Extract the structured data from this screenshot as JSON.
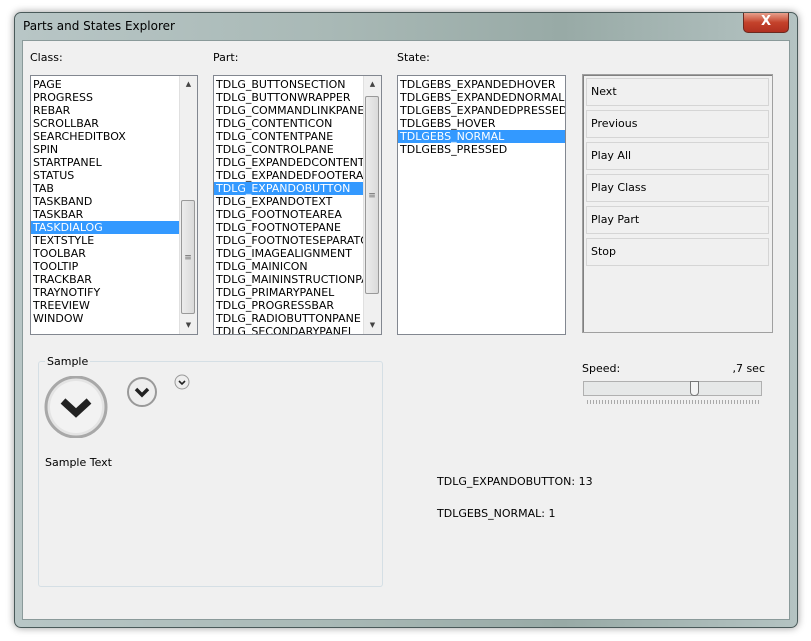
{
  "window": {
    "title": "Parts and States Explorer",
    "close_label": "X"
  },
  "class": {
    "label": "Class:",
    "items": [
      "PAGE",
      "PROGRESS",
      "REBAR",
      "SCROLLBAR",
      "SEARCHEDITBOX",
      "SPIN",
      "STARTPANEL",
      "STATUS",
      "TAB",
      "TASKBAND",
      "TASKBAR",
      "TASKDIALOG",
      "TEXTSTYLE",
      "TOOLBAR",
      "TOOLTIP",
      "TRACKBAR",
      "TRAYNOTIFY",
      "TREEVIEW",
      "WINDOW"
    ],
    "selected": "TASKDIALOG"
  },
  "part": {
    "label": "Part:",
    "items": [
      "TDLG_BUTTONSECTION",
      "TDLG_BUTTONWRAPPER",
      "TDLG_COMMANDLINKPANE",
      "TDLG_CONTENTICON",
      "TDLG_CONTENTPANE",
      "TDLG_CONTROLPANE",
      "TDLG_EXPANDEDCONTENT",
      "TDLG_EXPANDEDFOOTERAREA",
      "TDLG_EXPANDOBUTTON",
      "TDLG_EXPANDOTEXT",
      "TDLG_FOOTNOTEAREA",
      "TDLG_FOOTNOTEPANE",
      "TDLG_FOOTNOTESEPARATOR",
      "TDLG_IMAGEALIGNMENT",
      "TDLG_MAINICON",
      "TDLG_MAININSTRUCTIONPANE",
      "TDLG_PRIMARYPANEL",
      "TDLG_PROGRESSBAR",
      "TDLG_RADIOBUTTONPANE",
      "TDLG_SECONDARYPANEL"
    ],
    "selected": "TDLG_EXPANDOBUTTON"
  },
  "state": {
    "label": "State:",
    "items": [
      "TDLGEBS_EXPANDEDHOVER",
      "TDLGEBS_EXPANDEDNORMAL",
      "TDLGEBS_EXPANDEDPRESSED",
      "TDLGEBS_HOVER",
      "TDLGEBS_NORMAL",
      "TDLGEBS_PRESSED"
    ],
    "selected": "TDLGEBS_NORMAL"
  },
  "buttons": [
    "Next",
    "Previous",
    "Play All",
    "Play Class",
    "Play Part",
    "Stop"
  ],
  "sample": {
    "label": "Sample",
    "text": "Sample Text"
  },
  "speed": {
    "label": "Speed:",
    "value": ",7 sec",
    "slider_fraction": 0.64
  },
  "info": {
    "part": "TDLG_EXPANDOBUTTON: 13",
    "state": "TDLGEBS_NORMAL: 1"
  },
  "colors": {
    "selection": "#3399ff",
    "background": "#f0f0f0"
  }
}
